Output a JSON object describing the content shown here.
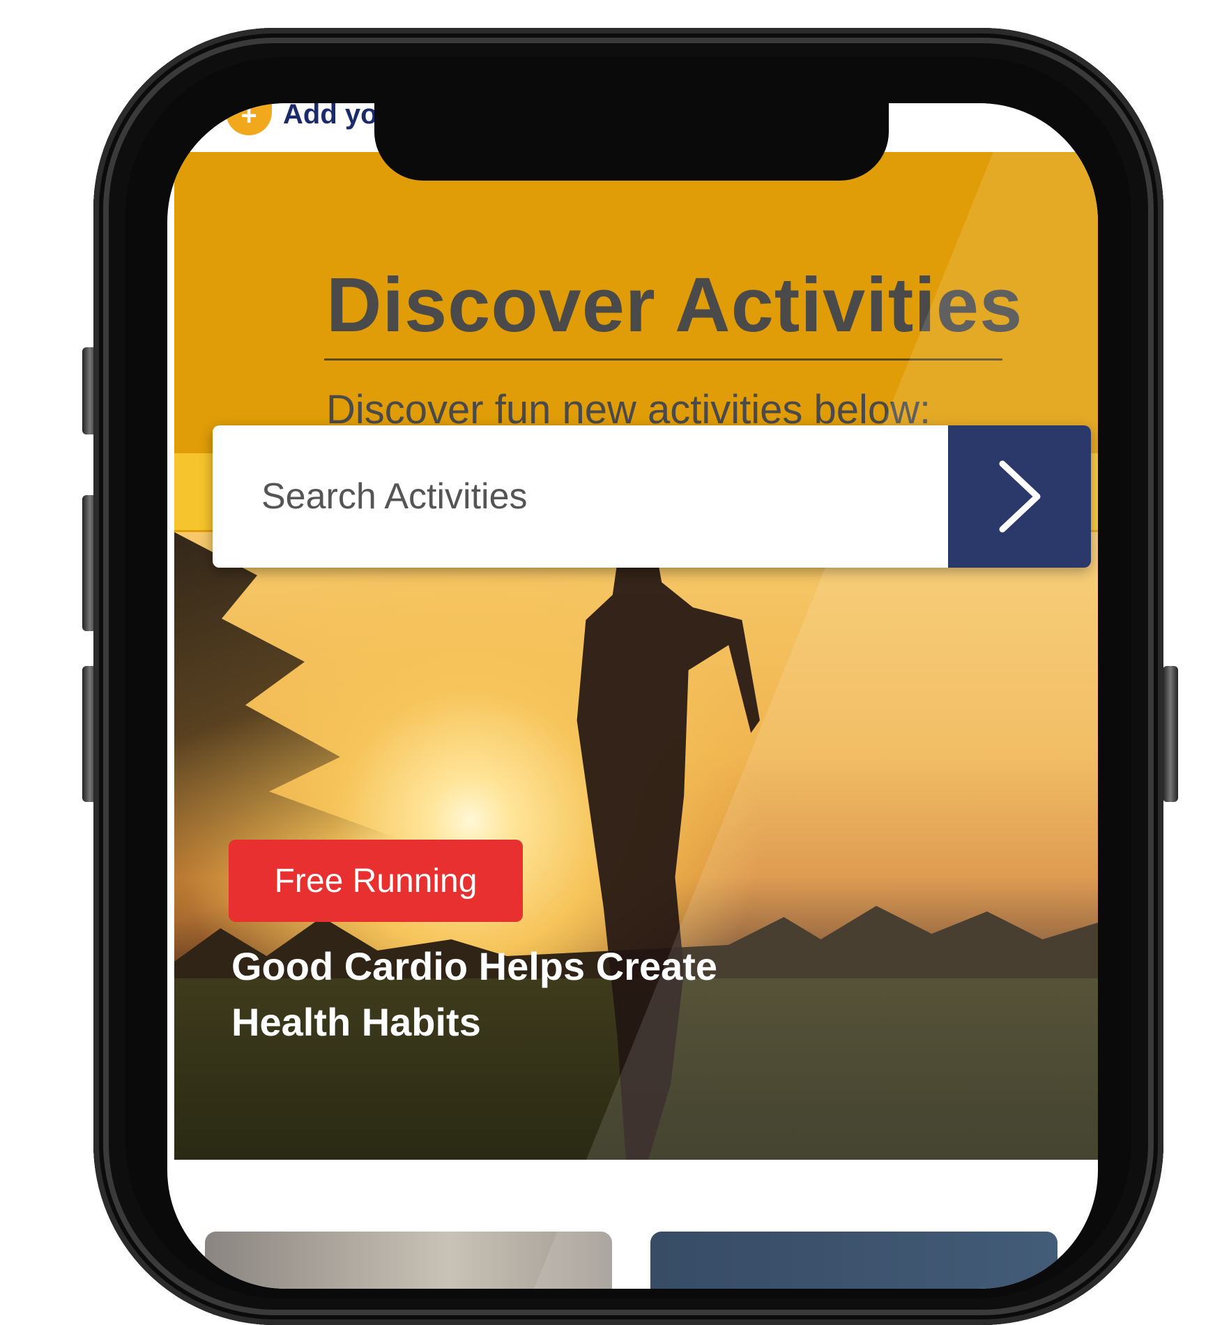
{
  "status_strip": {
    "add_text": "Add yo",
    "add_icon": "plus-icon"
  },
  "header": {
    "title": "Discover Activities",
    "subtitle": "Discover fun new activities below:"
  },
  "search": {
    "placeholder": "Search Activities",
    "submit_icon": "chevron-right-icon"
  },
  "featured": {
    "category": "Free Running",
    "headline": "Good Cardio Helps Create Health Habits"
  },
  "colors": {
    "header_band": "#e09d07",
    "search_button": "#0e1e55",
    "badge": "#e7302f"
  }
}
